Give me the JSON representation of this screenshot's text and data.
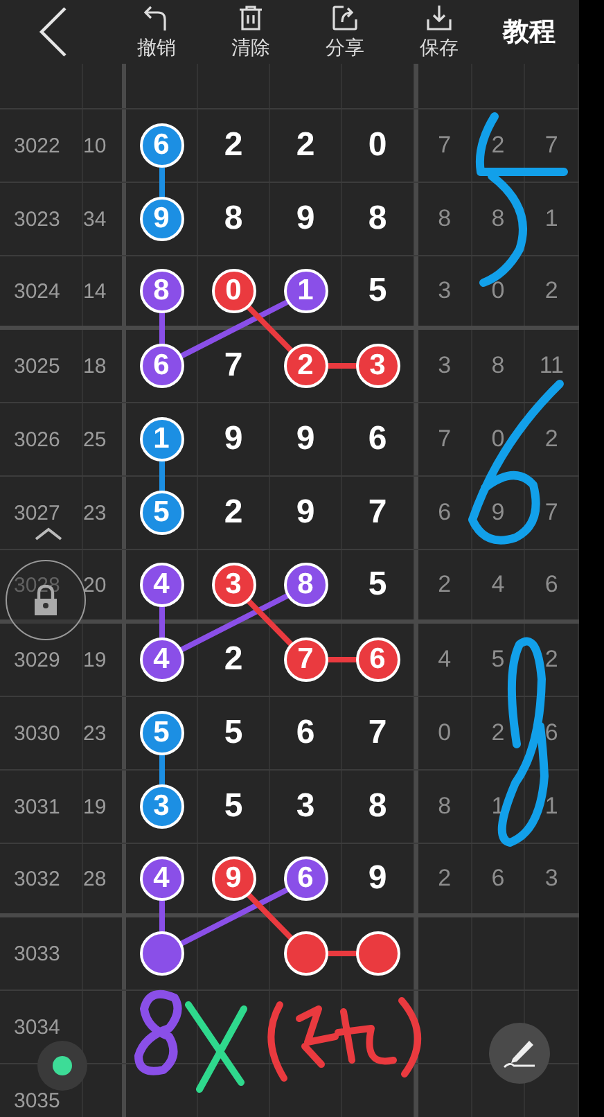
{
  "toolbar": {
    "actions": [
      {
        "kind": "undo",
        "label": "撤销"
      },
      {
        "kind": "trash",
        "label": "清除"
      },
      {
        "kind": "share",
        "label": "分享"
      },
      {
        "kind": "save",
        "label": "保存"
      }
    ],
    "tutorial": "教程"
  },
  "rows": [
    {
      "period": "3022",
      "sum": "10",
      "digits": [
        {
          "kind": "ball",
          "value": "6",
          "color": "#1c8fe3"
        },
        {
          "kind": "number",
          "value": "2"
        },
        {
          "kind": "number",
          "value": "2"
        },
        {
          "kind": "number",
          "value": "0"
        }
      ],
      "miss": [
        "7",
        "2",
        "7"
      ],
      "group_end": false
    },
    {
      "period": "3023",
      "sum": "34",
      "digits": [
        {
          "kind": "ball",
          "value": "9",
          "color": "#1c8fe3"
        },
        {
          "kind": "number",
          "value": "8"
        },
        {
          "kind": "number",
          "value": "9"
        },
        {
          "kind": "number",
          "value": "8"
        }
      ],
      "miss": [
        "8",
        "8",
        "1"
      ],
      "group_end": false
    },
    {
      "period": "3024",
      "sum": "14",
      "digits": [
        {
          "kind": "ball",
          "value": "8",
          "color": "#8a4fe8"
        },
        {
          "kind": "ball",
          "value": "0",
          "color": "#ea3a3f"
        },
        {
          "kind": "ball",
          "value": "1",
          "color": "#8a4fe8"
        },
        {
          "kind": "number",
          "value": "5"
        }
      ],
      "miss": [
        "3",
        "0",
        "2"
      ],
      "group_end": true
    },
    {
      "period": "3025",
      "sum": "18",
      "digits": [
        {
          "kind": "ball",
          "value": "6",
          "color": "#8a4fe8"
        },
        {
          "kind": "number",
          "value": "7"
        },
        {
          "kind": "ball",
          "value": "2",
          "color": "#ea3a3f"
        },
        {
          "kind": "ball",
          "value": "3",
          "color": "#ea3a3f"
        }
      ],
      "miss": [
        "3",
        "8",
        "11"
      ],
      "group_end": false
    },
    {
      "period": "3026",
      "sum": "25",
      "digits": [
        {
          "kind": "ball",
          "value": "1",
          "color": "#1c8fe3"
        },
        {
          "kind": "number",
          "value": "9"
        },
        {
          "kind": "number",
          "value": "9"
        },
        {
          "kind": "number",
          "value": "6"
        }
      ],
      "miss": [
        "7",
        "0",
        "2"
      ],
      "group_end": false
    },
    {
      "period": "3027",
      "sum": "23",
      "digits": [
        {
          "kind": "ball",
          "value": "5",
          "color": "#1c8fe3"
        },
        {
          "kind": "number",
          "value": "2"
        },
        {
          "kind": "number",
          "value": "9"
        },
        {
          "kind": "number",
          "value": "7"
        }
      ],
      "miss": [
        "6",
        "9",
        "7"
      ],
      "group_end": false
    },
    {
      "period": "3028",
      "sum": "20",
      "digits": [
        {
          "kind": "ball",
          "value": "4",
          "color": "#8a4fe8"
        },
        {
          "kind": "ball",
          "value": "3",
          "color": "#ea3a3f"
        },
        {
          "kind": "ball",
          "value": "8",
          "color": "#8a4fe8"
        },
        {
          "kind": "number",
          "value": "5"
        }
      ],
      "miss": [
        "2",
        "4",
        "6"
      ],
      "group_end": true
    },
    {
      "period": "3029",
      "sum": "19",
      "digits": [
        {
          "kind": "ball",
          "value": "4",
          "color": "#8a4fe8"
        },
        {
          "kind": "number",
          "value": "2"
        },
        {
          "kind": "ball",
          "value": "7",
          "color": "#ea3a3f"
        },
        {
          "kind": "ball",
          "value": "6",
          "color": "#ea3a3f"
        }
      ],
      "miss": [
        "4",
        "5",
        "2"
      ],
      "group_end": false
    },
    {
      "period": "3030",
      "sum": "23",
      "digits": [
        {
          "kind": "ball",
          "value": "5",
          "color": "#1c8fe3"
        },
        {
          "kind": "number",
          "value": "5"
        },
        {
          "kind": "number",
          "value": "6"
        },
        {
          "kind": "number",
          "value": "7"
        }
      ],
      "miss": [
        "0",
        "2",
        "6"
      ],
      "group_end": false
    },
    {
      "period": "3031",
      "sum": "19",
      "digits": [
        {
          "kind": "ball",
          "value": "3",
          "color": "#1c8fe3"
        },
        {
          "kind": "number",
          "value": "5"
        },
        {
          "kind": "number",
          "value": "3"
        },
        {
          "kind": "number",
          "value": "8"
        }
      ],
      "miss": [
        "8",
        "1",
        "1"
      ],
      "group_end": false
    },
    {
      "period": "3032",
      "sum": "28",
      "digits": [
        {
          "kind": "ball",
          "value": "4",
          "color": "#8a4fe8"
        },
        {
          "kind": "ball",
          "value": "9",
          "color": "#ea3a3f"
        },
        {
          "kind": "ball",
          "value": "6",
          "color": "#8a4fe8"
        },
        {
          "kind": "number",
          "value": "9"
        }
      ],
      "miss": [
        "2",
        "6",
        "3"
      ],
      "group_end": true
    },
    {
      "period": "3033",
      "digits": [
        {
          "kind": "ball",
          "color": "#8a4fe8"
        },
        {
          "kind": "blank"
        },
        {
          "kind": "ball",
          "color": "#ea3a3f"
        },
        {
          "kind": "ball",
          "color": "#ea3a3f"
        }
      ],
      "group_end": false
    },
    {
      "period": "3034",
      "group_end": false
    },
    {
      "period": "3035",
      "group_end": false
    }
  ]
}
